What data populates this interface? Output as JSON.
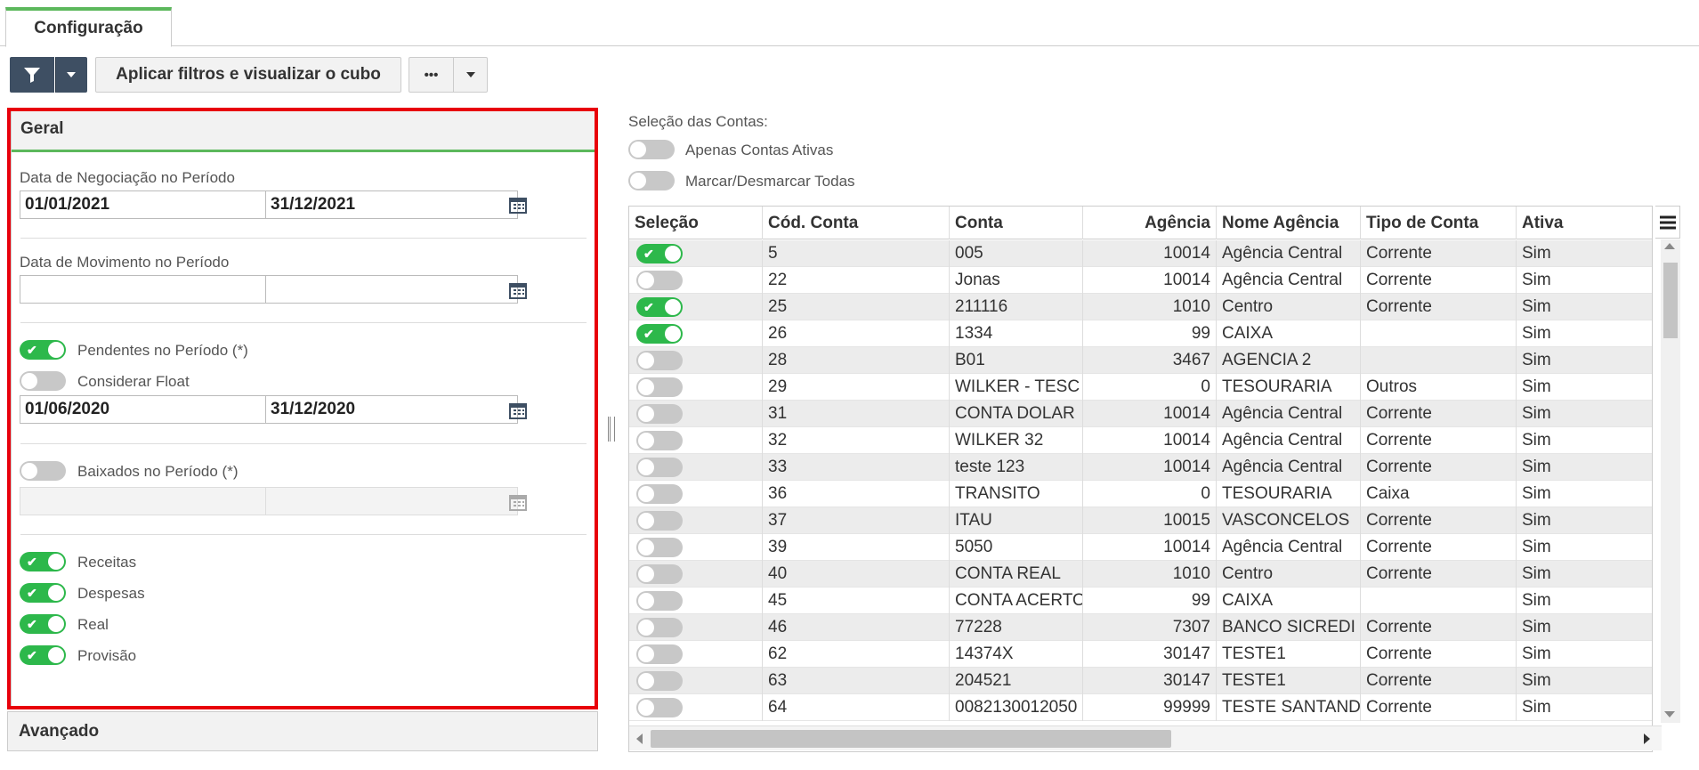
{
  "tabs": [
    {
      "label": "Configuração"
    }
  ],
  "toolbar": {
    "apply_label": "Aplicar filtros e visualizar o cubo",
    "more_label": "•••"
  },
  "geral": {
    "title": "Geral",
    "negociacao": {
      "label": "Data de Negociação no Período",
      "from": "01/01/2021",
      "to": "31/12/2021"
    },
    "movimento": {
      "label": "Data de Movimento no Período",
      "from": "",
      "to": ""
    },
    "pendentes": {
      "label": "Pendentes no Período (*)",
      "on": true
    },
    "float": {
      "label": "Considerar Float",
      "on": false,
      "from": "01/06/2020",
      "to": "31/12/2020"
    },
    "baixados": {
      "label": "Baixados no Período (*)",
      "on": false,
      "from": "",
      "to": ""
    },
    "receitas": {
      "label": "Receitas",
      "on": true
    },
    "despesas": {
      "label": "Despesas",
      "on": true
    },
    "real": {
      "label": "Real",
      "on": true
    },
    "provisao": {
      "label": "Provisão",
      "on": true
    }
  },
  "avancado": {
    "title": "Avançado"
  },
  "contas": {
    "title": "Seleção das Contas:",
    "ativas": {
      "label": "Apenas Contas Ativas",
      "on": false
    },
    "todas": {
      "label": "Marcar/Desmarcar Todas",
      "on": false
    },
    "columns": [
      "Seleção",
      "Cód. Conta",
      "Conta",
      "Agência",
      "Nome Agência",
      "Tipo de Conta",
      "Ativa"
    ],
    "rows": [
      {
        "sel": true,
        "cod": "5",
        "conta": "005",
        "agencia": "10014",
        "nome": "Agência Central",
        "tipo": "Corrente",
        "ativa": "Sim"
      },
      {
        "sel": false,
        "cod": "22",
        "conta": "Jonas",
        "agencia": "10014",
        "nome": "Agência Central",
        "tipo": "Corrente",
        "ativa": "Sim"
      },
      {
        "sel": true,
        "cod": "25",
        "conta": "211116",
        "agencia": "1010",
        "nome": "Centro",
        "tipo": "Corrente",
        "ativa": "Sim"
      },
      {
        "sel": true,
        "cod": "26",
        "conta": "1334",
        "agencia": "99",
        "nome": "CAIXA",
        "tipo": "",
        "ativa": "Sim"
      },
      {
        "sel": false,
        "cod": "28",
        "conta": "B01",
        "agencia": "3467",
        "nome": "AGENCIA 2",
        "tipo": "",
        "ativa": "Sim"
      },
      {
        "sel": false,
        "cod": "29",
        "conta": "WILKER - TESC",
        "agencia": "0",
        "nome": "TESOURARIA",
        "tipo": "Outros",
        "ativa": "Sim"
      },
      {
        "sel": false,
        "cod": "31",
        "conta": "CONTA DOLAR",
        "agencia": "10014",
        "nome": "Agência Central",
        "tipo": "Corrente",
        "ativa": "Sim"
      },
      {
        "sel": false,
        "cod": "32",
        "conta": "WILKER 32",
        "agencia": "10014",
        "nome": "Agência Central",
        "tipo": "Corrente",
        "ativa": "Sim"
      },
      {
        "sel": false,
        "cod": "33",
        "conta": "teste 123",
        "agencia": "10014",
        "nome": "Agência Central",
        "tipo": "Corrente",
        "ativa": "Sim"
      },
      {
        "sel": false,
        "cod": "36",
        "conta": "TRANSITO",
        "agencia": "0",
        "nome": "TESOURARIA",
        "tipo": "Caixa",
        "ativa": "Sim"
      },
      {
        "sel": false,
        "cod": "37",
        "conta": "ITAU",
        "agencia": "10015",
        "nome": "VASCONCELOS",
        "tipo": "Corrente",
        "ativa": "Sim"
      },
      {
        "sel": false,
        "cod": "39",
        "conta": "5050",
        "agencia": "10014",
        "nome": "Agência Central",
        "tipo": "Corrente",
        "ativa": "Sim"
      },
      {
        "sel": false,
        "cod": "40",
        "conta": "CONTA REAL",
        "agencia": "1010",
        "nome": "Centro",
        "tipo": "Corrente",
        "ativa": "Sim"
      },
      {
        "sel": false,
        "cod": "45",
        "conta": "CONTA ACERTO",
        "agencia": "99",
        "nome": "CAIXA",
        "tipo": "",
        "ativa": "Sim"
      },
      {
        "sel": false,
        "cod": "46",
        "conta": "77228",
        "agencia": "7307",
        "nome": "BANCO SICREDI",
        "tipo": "Corrente",
        "ativa": "Sim"
      },
      {
        "sel": false,
        "cod": "62",
        "conta": "14374X",
        "agencia": "30147",
        "nome": "TESTE1",
        "tipo": "Corrente",
        "ativa": "Sim"
      },
      {
        "sel": false,
        "cod": "63",
        "conta": "204521",
        "agencia": "30147",
        "nome": "TESTE1",
        "tipo": "Corrente",
        "ativa": "Sim"
      },
      {
        "sel": false,
        "cod": "64",
        "conta": "0082130012050",
        "agencia": "99999",
        "nome": "TESTE SANTANDER",
        "tipo": "Corrente",
        "ativa": "Sim"
      }
    ]
  }
}
